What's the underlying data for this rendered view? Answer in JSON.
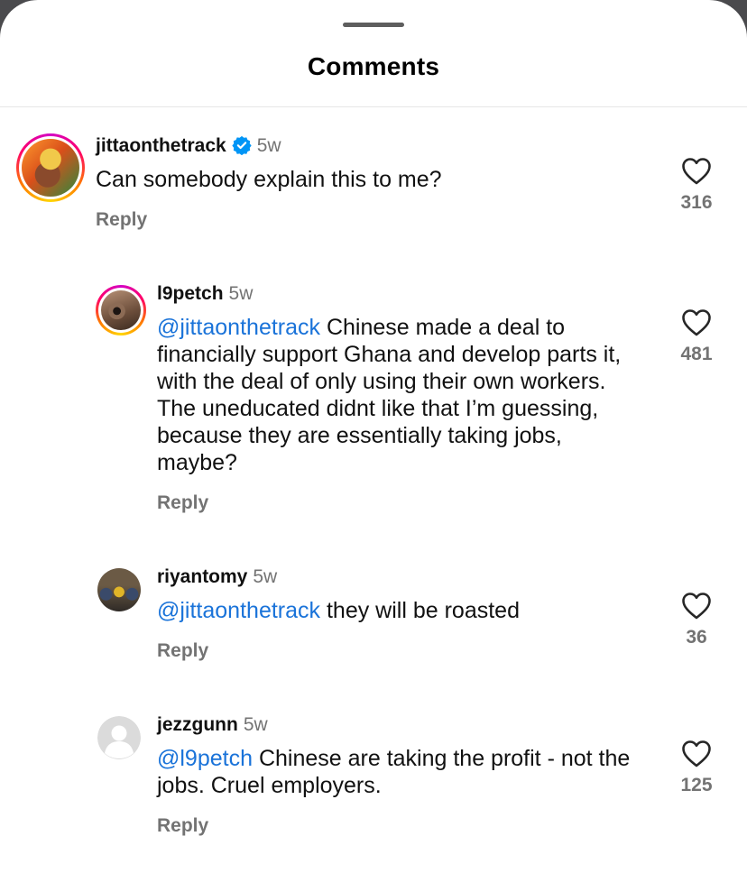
{
  "sheet": {
    "title": "Comments"
  },
  "comments": [
    {
      "username": "jittaonthetrack",
      "verified": true,
      "time": "5w",
      "text": "Can somebody explain this to me?",
      "reply_label": "Reply",
      "likes": "316",
      "avatar_icon": "user-photo-icon"
    },
    {
      "username": "l9petch",
      "time": "5w",
      "mention": "@jittaonthetrack",
      "text": " Chinese made a deal to financially support Ghana and develop parts it, with the deal of only using their own workers. The uneducated didnt like that I’m guessing, because they are essentially taking jobs, maybe?",
      "reply_label": "Reply",
      "likes": "481",
      "avatar_icon": "user-photo-icon"
    },
    {
      "username": "riyantomy",
      "time": "5w",
      "mention": "@jittaonthetrack",
      "text": " they will be roasted",
      "reply_label": "Reply",
      "likes": "36",
      "avatar_icon": "user-photo-icon"
    },
    {
      "username": "jezzgunn",
      "time": "5w",
      "mention": "@l9petch",
      "text": " Chinese are taking the profit - not the jobs. Cruel employers.",
      "reply_label": "Reply",
      "likes": "125",
      "avatar_icon": "default-avatar-icon"
    }
  ],
  "colors": {
    "mention": "#1a73d9",
    "secondary_text": "#737373",
    "verified": "#0095f6"
  }
}
